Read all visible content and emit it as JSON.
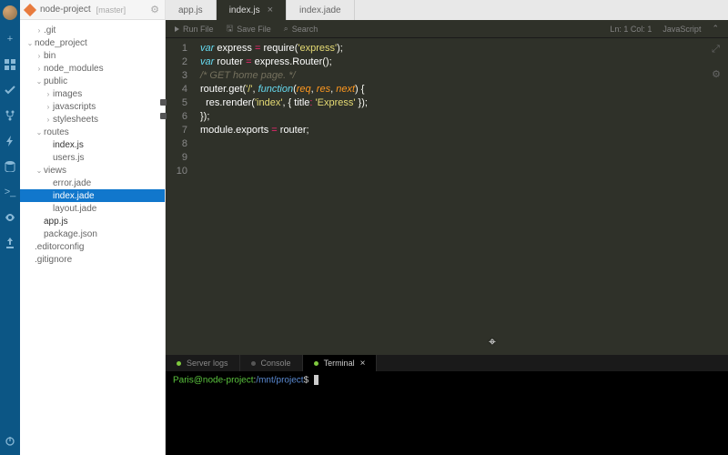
{
  "header": {
    "project": "node-project",
    "branch": "[master]"
  },
  "activity_icons": [
    "plus",
    "grid",
    "check",
    "fork",
    "bolt",
    "db",
    "terminal",
    "eye",
    "deploy"
  ],
  "tree": [
    {
      "l": ".git",
      "d": 1,
      "arrow": ">"
    },
    {
      "l": "node_project",
      "d": 0,
      "arrow": "v"
    },
    {
      "l": "bin",
      "d": 1,
      "arrow": ">"
    },
    {
      "l": "node_modules",
      "d": 1,
      "arrow": ">"
    },
    {
      "l": "public",
      "d": 1,
      "arrow": "v"
    },
    {
      "l": "images",
      "d": 2,
      "arrow": ">"
    },
    {
      "l": "javascripts",
      "d": 2,
      "arrow": ">"
    },
    {
      "l": "stylesheets",
      "d": 2,
      "arrow": ">"
    },
    {
      "l": "routes",
      "d": 1,
      "arrow": "v"
    },
    {
      "l": "index.js",
      "d": 2,
      "bold": true
    },
    {
      "l": "users.js",
      "d": 2
    },
    {
      "l": "views",
      "d": 1,
      "arrow": "v"
    },
    {
      "l": "error.jade",
      "d": 2
    },
    {
      "l": "index.jade",
      "d": 2,
      "sel": true
    },
    {
      "l": "layout.jade",
      "d": 2
    },
    {
      "l": "app.js",
      "d": 1,
      "bold": true
    },
    {
      "l": "package.json",
      "d": 1
    },
    {
      "l": ".editorconfig",
      "d": 0
    },
    {
      "l": ".gitignore",
      "d": 0
    }
  ],
  "tabs": [
    {
      "l": "app.js"
    },
    {
      "l": "index.js",
      "active": true,
      "close": true
    },
    {
      "l": "index.jade"
    }
  ],
  "toolbar": {
    "run": "Run File",
    "save": "Save File",
    "search": "Search",
    "status": "Ln: 1 Col: 1",
    "lang": "JavaScript"
  },
  "code": [
    {
      "n": 1,
      "h": "<span class='kw'>var</span> <span class='nm'>express</span> <span class='op'>=</span> <span class='nm'>require</span>(<span class='str'>'express'</span>);"
    },
    {
      "n": 2,
      "h": "<span class='kw'>var</span> <span class='nm'>router</span> <span class='op'>=</span> <span class='nm'>express</span>.<span class='nm'>Router</span>();"
    },
    {
      "n": 3,
      "h": ""
    },
    {
      "n": 4,
      "h": "<span class='cmt'>/* GET home page. */</span>"
    },
    {
      "n": 5,
      "fold": true,
      "h": "<span class='nm'>router</span>.<span class='nm'>get</span>(<span class='str'>'/'</span>, <span class='fn'>function</span>(<span class='arg'>req</span>, <span class='arg'>res</span>, <span class='arg'>next</span>) {"
    },
    {
      "n": 6,
      "fold": true,
      "h": "  <span class='nm'>res</span>.<span class='nm'>render</span>(<span class='str'>'index'</span>, { <span class='nm'>title</span><span class='op'>:</span> <span class='str'>'Express'</span> });"
    },
    {
      "n": 7,
      "h": "});"
    },
    {
      "n": 8,
      "h": ""
    },
    {
      "n": 9,
      "h": "<span class='nm'>module</span>.<span class='nm'>exports</span> <span class='op'>=</span> <span class='nm'>router</span>;"
    },
    {
      "n": 10,
      "h": ""
    }
  ],
  "panel_tabs": [
    {
      "l": "Server logs",
      "dot": "green"
    },
    {
      "l": "Console",
      "dot": ""
    },
    {
      "l": "Terminal",
      "dot": "green",
      "active": true,
      "close": true
    }
  ],
  "terminal": {
    "user": "Paris@node-project",
    "sep": ":",
    "path": "/mnt/project",
    "prompt": "$"
  }
}
